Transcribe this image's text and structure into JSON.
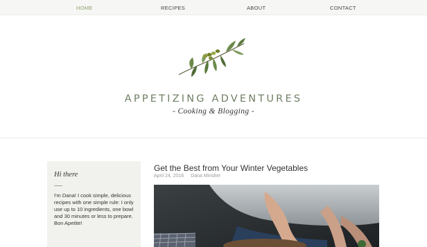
{
  "nav": {
    "items": [
      {
        "label": "HOME",
        "active": true
      },
      {
        "label": "RECIPES",
        "active": false
      },
      {
        "label": "ABOUT",
        "active": false
      },
      {
        "label": "CONTACT",
        "active": false
      }
    ]
  },
  "header": {
    "title": "APPETIZING ADVENTURES",
    "subtitle": "- Cooking & Blogging -",
    "logo_icon": "olive-branch-icon"
  },
  "sidebar": {
    "title": "Hi there",
    "text": "I'm Dana! I cook simple, delicious recipes with one simple rule: I only use up to 10 ingredients, one bowl and 30 minutes or less to prepare. Bon Apetite!"
  },
  "post": {
    "title": "Get the Best from Your Winter Vegetables",
    "date": "April 24, 2016",
    "author": "Dana Minsker"
  },
  "colors": {
    "nav_bg": "#f6f6f4",
    "nav_active": "#8aa06f",
    "title_green": "#6f7f64",
    "sidebar_bg": "#f1f1ee"
  }
}
